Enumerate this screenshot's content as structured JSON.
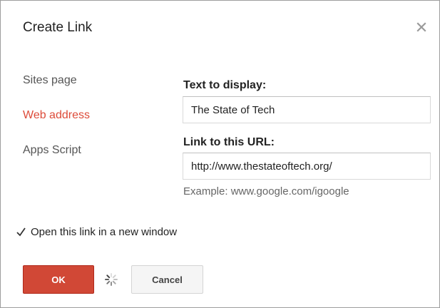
{
  "dialog": {
    "title": "Create Link",
    "close_icon": "close-icon"
  },
  "nav": {
    "items": [
      {
        "label": "Sites page",
        "active": false
      },
      {
        "label": "Web address",
        "active": true
      },
      {
        "label": "Apps Script",
        "active": false
      }
    ]
  },
  "form": {
    "text_label": "Text to display:",
    "text_value": "The State of Tech",
    "url_label": "Link to this URL:",
    "url_value": "http://www.thestateoftech.org/",
    "url_hint": "Example: www.google.com/igoogle",
    "new_window_label": "Open this link in a new window",
    "new_window_checked": true
  },
  "buttons": {
    "ok_label": "OK",
    "cancel_label": "Cancel",
    "spinner_icon": "loading-spinner-icon"
  },
  "colors": {
    "accent_red": "#dd4b39",
    "ok_button": "#d14836"
  }
}
